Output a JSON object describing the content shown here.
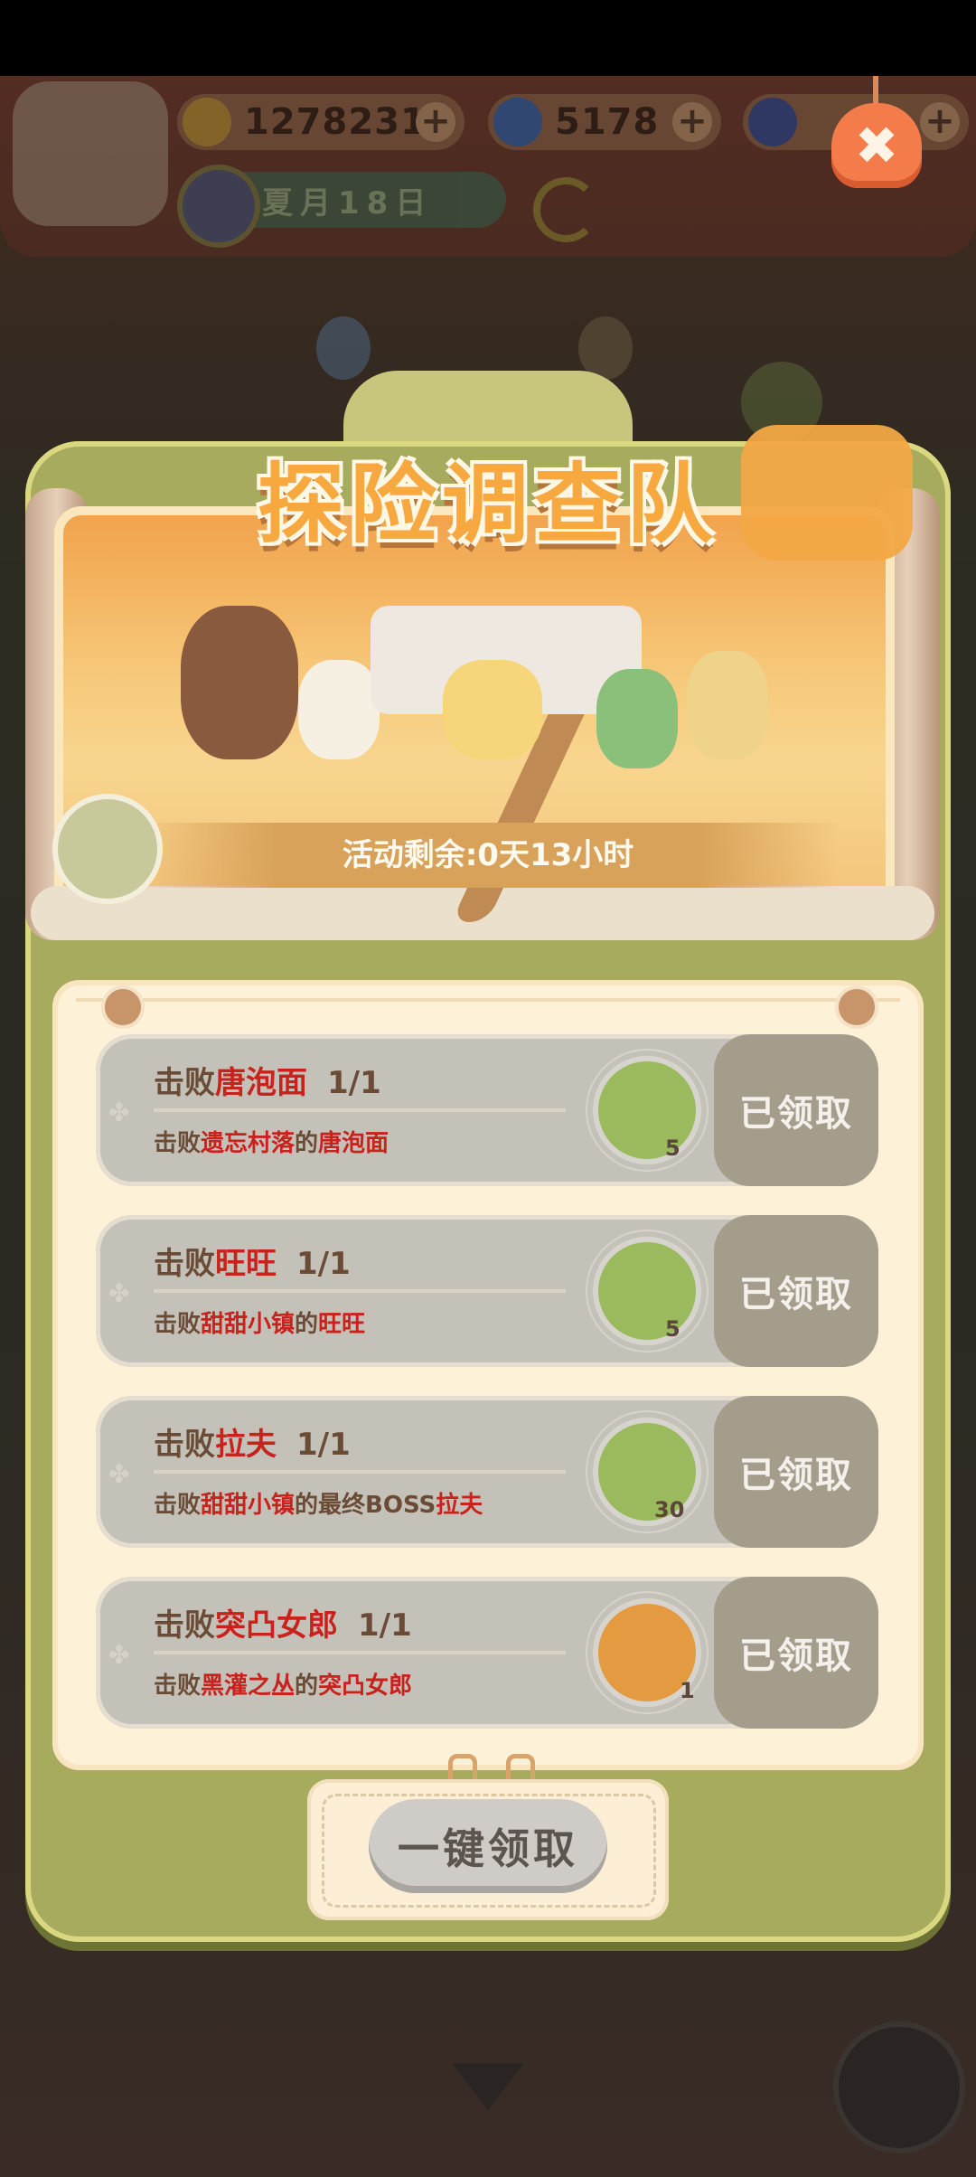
{
  "hud": {
    "bananas": "1278231",
    "flames": "5178",
    "date": "夏月18日",
    "plus": "+"
  },
  "close_label": "✖",
  "event": {
    "title": "探险调查队",
    "timer": "活动剩余:0天13小时"
  },
  "tasks": [
    {
      "title_prefix": "击败",
      "title_target": "唐泡面",
      "progress": "1/1",
      "desc_prefix": "击败",
      "desc_place": "遗忘村落",
      "desc_mid": "的",
      "desc_target": "唐泡面",
      "reward_count": "5",
      "reward_icon": "paw-drumstick-icon",
      "claim": "已领取"
    },
    {
      "title_prefix": "击败",
      "title_target": "旺旺",
      "progress": "1/1",
      "desc_prefix": "击败",
      "desc_place": "甜甜小镇",
      "desc_mid": "的",
      "desc_target": "旺旺",
      "reward_count": "5",
      "reward_icon": "paw-drumstick-icon",
      "claim": "已领取"
    },
    {
      "title_prefix": "击败",
      "title_target": "拉夫",
      "progress": "1/1",
      "desc_prefix": "击败",
      "desc_place": "甜甜小镇",
      "desc_mid": "的最终BOSS",
      "desc_target": "拉夫",
      "reward_count": "30",
      "reward_icon": "bear-plush-icon",
      "claim": "已领取"
    },
    {
      "title_prefix": "击败",
      "title_target": "突凸女郎",
      "progress": "1/1",
      "desc_prefix": "击败",
      "desc_place": "黑灌之丛",
      "desc_mid": "的",
      "desc_target": "突凸女郎",
      "reward_count": "1",
      "reward_icon": "tiger-icon",
      "claim": "已领取"
    }
  ],
  "claim_all": "一键领取",
  "colors": {
    "panel": "#a7ab5d",
    "title": "#f7a83e",
    "highlight": "#c9211c",
    "claimed": "#a59d8c"
  }
}
